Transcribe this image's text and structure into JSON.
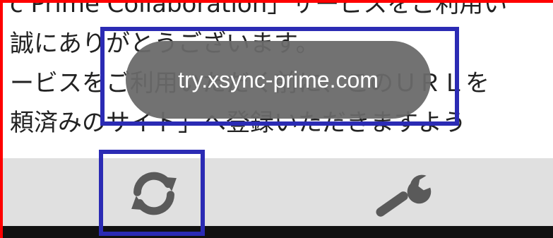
{
  "background_text": {
    "line1": "c Prime Collaboration」サービスをご利用い",
    "line2": "誠にありがとうございます。",
    "line3": "ービスをご利用いただく前に、このＵＲＬを",
    "line4": "頼済みのサイト」へ登録いただきますよう"
  },
  "toast": {
    "text": "try.xsync-prime.com"
  },
  "toolbar": {
    "sync_icon": "sync-icon",
    "wrench_icon": "wrench-icon"
  },
  "colors": {
    "toolbar_bg": "#e0e0e0",
    "toast_bg": "#696969",
    "icon_color": "#5a5a5a",
    "highlight_border": "#2b2bb4",
    "frame_border": "#ff0000"
  }
}
